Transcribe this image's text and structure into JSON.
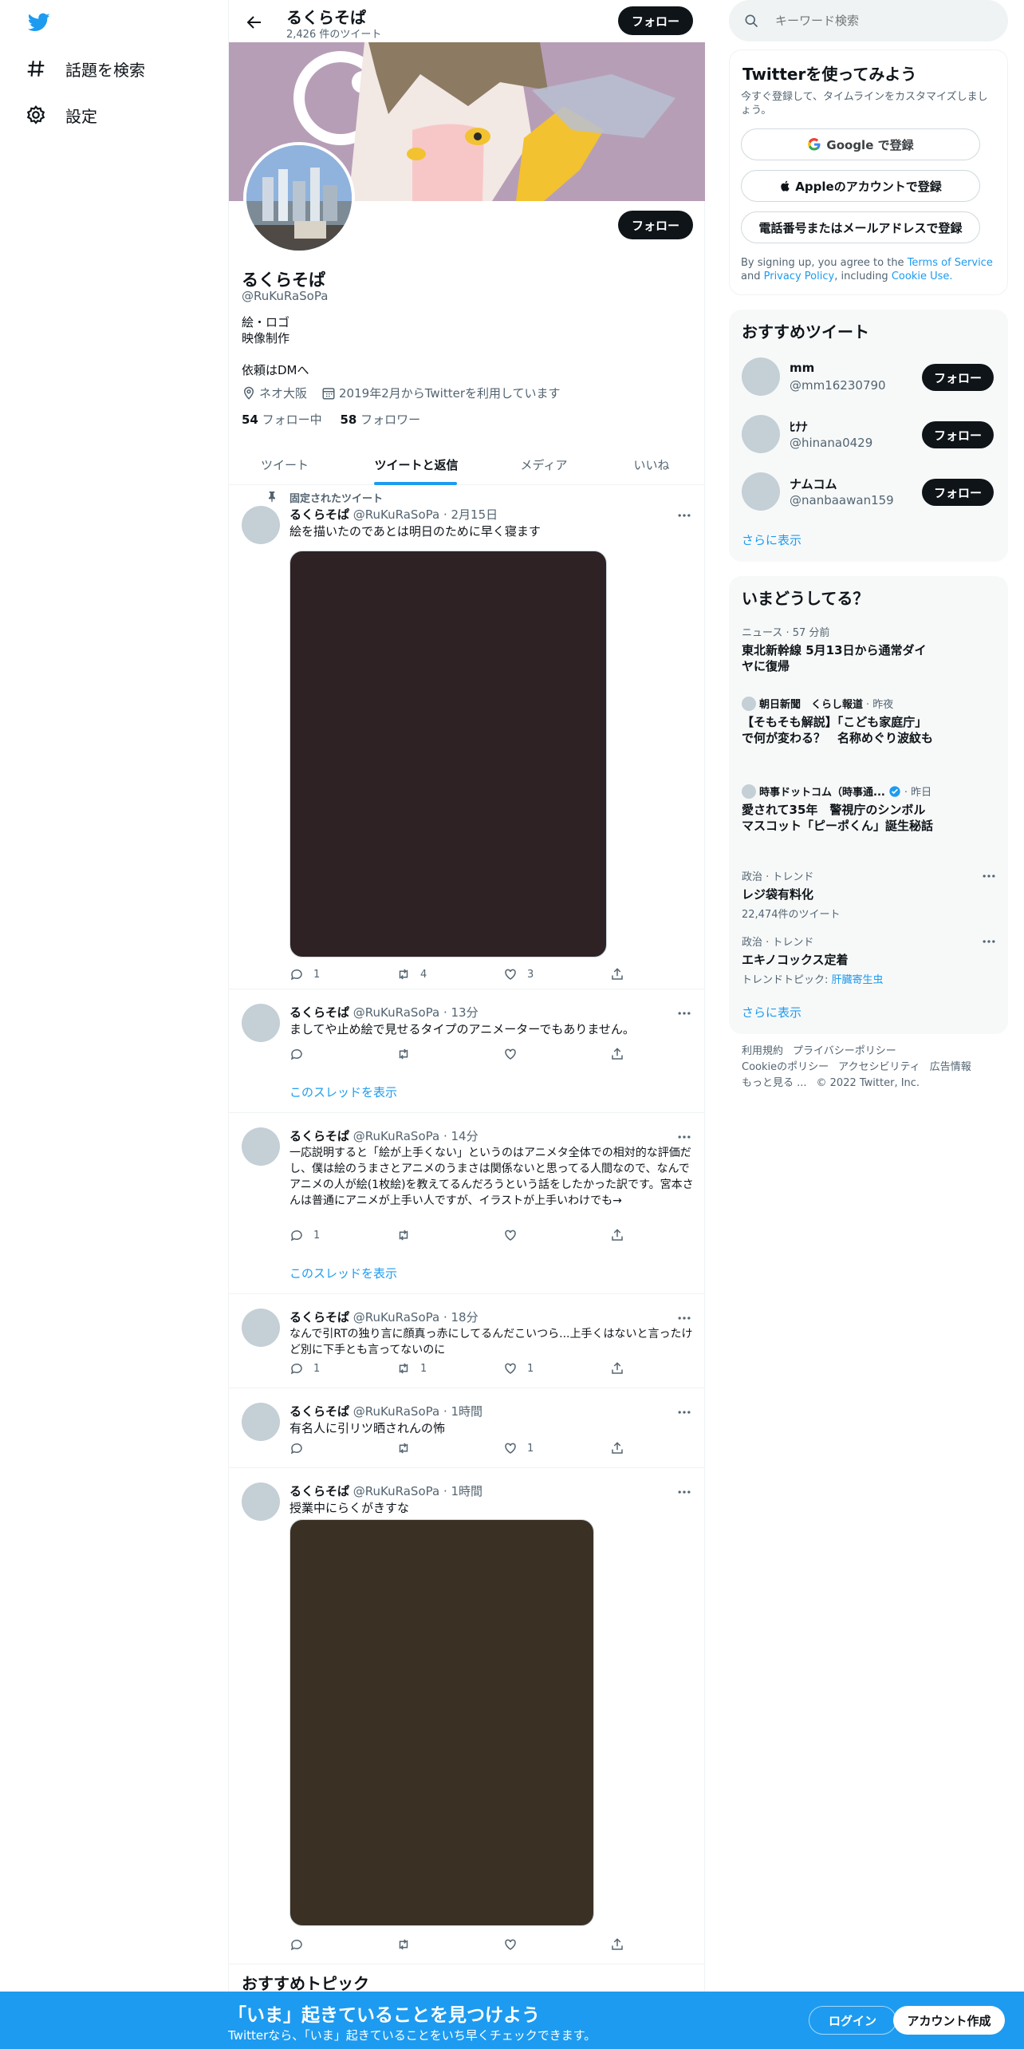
{
  "nav": {
    "explore_label": "話題を検索",
    "settings_label": "設定"
  },
  "header": {
    "name": "るくらそぱ",
    "tweet_count": "2,426 件のツイート",
    "follow_label": "フォロー"
  },
  "profile": {
    "name": "るくらそぱ",
    "handle": "@RuKuRaSoPa",
    "follow_label": "フォロー",
    "bio_line1": "絵・ロゴ",
    "bio_line2": "映像制作",
    "bio_line3": "依頼はDMへ",
    "location": "ネオ大阪",
    "joined": "2019年2月からTwitterを利用しています",
    "following_count": "54",
    "following_label": "フォロー中",
    "followers_count": "58",
    "followers_label": "フォロワー"
  },
  "tabs": [
    "ツイート",
    "ツイートと返信",
    "メディア",
    "いいね"
  ],
  "pinned_label": "固定されたツイート",
  "thread_label": "このスレッドを表示",
  "tweets": [
    {
      "name": "るくらそぱ",
      "meta": "@RuKuRaSoPa · 2月15日",
      "text": "絵を描いたのであとは明日のために早く寝ます",
      "reply": "1",
      "retweet": "4",
      "like": "3",
      "media_color": "#2e2224"
    },
    {
      "name": "るくらそぱ",
      "meta": "@RuKuRaSoPa · 13分",
      "text": "ましてや止め絵で見せるタイプのアニメーターでもありません。",
      "reply": "",
      "retweet": "",
      "like": ""
    },
    {
      "name": "るくらそぱ",
      "meta": "@RuKuRaSoPa · 14分",
      "text": "一応説明すると「絵が上手くない」というのはアニメタ全体での相対的な評価だし、僕は絵のうまさとアニメのうまさは関係ないと思ってる人間なので、なんでアニメの人が絵(1枚絵)を教えてるんだろうという話をしたかった訳です。宮本さんは普通にアニメが上手い人ですが、イラストが上手いわけでも→",
      "reply": "1",
      "retweet": "",
      "like": ""
    },
    {
      "name": "るくらそぱ",
      "meta": "@RuKuRaSoPa · 18分",
      "text": "なんで引RTの独り言に顔真っ赤にしてるんだこいつら...上手くはないと言ったけど別に下手とも言ってないのに",
      "reply": "1",
      "retweet": "1",
      "like": "1"
    },
    {
      "name": "るくらそぱ",
      "meta": "@RuKuRaSoPa · 1時間",
      "text": "有名人に引リツ晒されんの怖",
      "reply": "",
      "retweet": "",
      "like": "1"
    },
    {
      "name": "るくらそぱ",
      "meta": "@RuKuRaSoPa · 1時間",
      "text": "授業中にらくがきすな",
      "reply": "",
      "retweet": "",
      "like": "",
      "media_color": "#3a3024"
    }
  ],
  "recommended_topics_title": "おすすめトピック",
  "right": {
    "search_placeholder": "キーワード検索",
    "signup": {
      "title": "Twitterを使ってみよう",
      "subtitle": "今すぐ登録して、タイムラインをカスタマイズしましょう。",
      "google": "Google で登録",
      "apple": "Appleのアカウントで登録",
      "phone": "電話番号またはメールアドレスで登録",
      "legal_pre": "By signing up, you agree to the",
      "tos": "Terms of Service",
      "and": "and",
      "privacy": "Privacy Policy",
      "including": ", including",
      "cookie": "Cookie Use."
    },
    "who_to_follow": {
      "title": "おすすめツイート",
      "users": [
        {
          "name": "mm",
          "handle": "@mm16230790"
        },
        {
          "name": "ﾋﾅﾅ",
          "handle": "@hinana0429"
        },
        {
          "name": "ナムコム",
          "handle": "@nanbaawan159"
        }
      ],
      "follow_label": "フォロー",
      "more": "さらに表示"
    },
    "trends": {
      "title": "いまどうしてる？",
      "items": [
        {
          "context": "ニュース · 57 分前",
          "title": "東北新幹線 5月13日から通常ダイヤに復帰"
        },
        {
          "source": "朝日新聞　くらし報道",
          "time": "· 昨夜",
          "title": "【そもそも解説】「こども家庭庁」で何が変わる？　名称めぐり波紋も"
        },
        {
          "source": "時事ドットコム（時事通...",
          "time": "· 昨日",
          "title": "愛されて35年　警視庁のシンボルマスコット「ピーポくん」誕生秘話"
        },
        {
          "context": "政治 · トレンド",
          "title": "レジ袋有料化",
          "sub": "22,474件のツイート"
        },
        {
          "context": "政治 · トレンド",
          "title": "エキノコックス定着",
          "sub_prefix": "トレンドトピック: ",
          "sub_link": "肝臓寄生虫"
        }
      ],
      "more": "さらに表示"
    },
    "footer": {
      "terms": "利用規約",
      "privacy": "プライバシーポリシー",
      "cookie": "Cookieのポリシー",
      "accessibility": "アクセシビリティ",
      "ads": "広告情報",
      "more": "もっと見る ...",
      "copyright": "© 2022 Twitter, Inc."
    }
  },
  "bottom_bar": {
    "title": "「いま」起きていることを見つけよう",
    "subtitle": "Twitterなら、「いま」起きていることをいち早くチェックできます。",
    "login": "ログイン",
    "signup": "アカウント作成"
  },
  "colors": {
    "accent": "#1d9bf0",
    "banner": "#b79eb7",
    "dark": "#0f1419"
  }
}
